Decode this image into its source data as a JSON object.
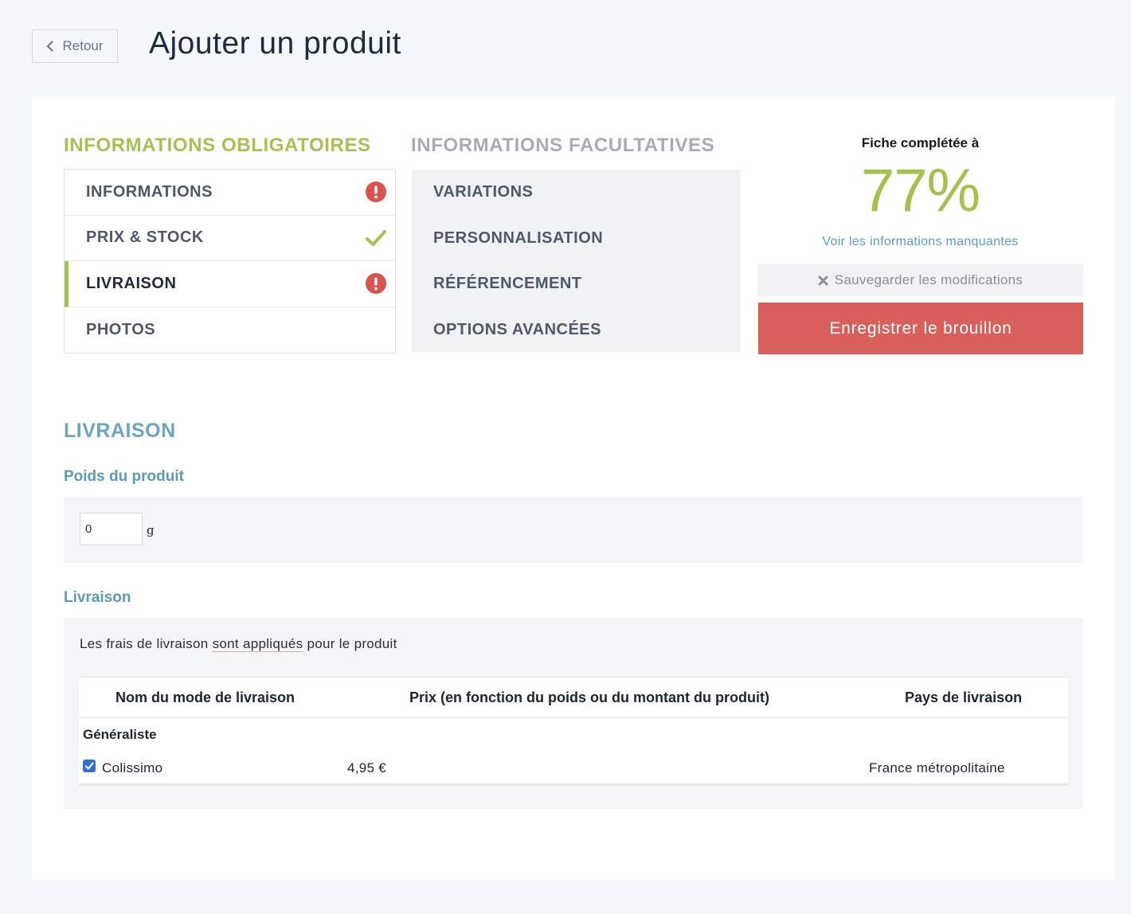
{
  "header": {
    "back_label": "Retour",
    "title": "Ajouter un produit"
  },
  "mandatory": {
    "heading": "INFORMATIONS OBLIGATOIRES",
    "items": [
      {
        "label": "INFORMATIONS",
        "status": "error"
      },
      {
        "label": "PRIX & STOCK",
        "status": "ok"
      },
      {
        "label": "LIVRAISON",
        "status": "error",
        "active": true
      },
      {
        "label": "PHOTOS",
        "status": "none"
      }
    ]
  },
  "optional": {
    "heading": "INFORMATIONS FACULTATIVES",
    "items": [
      {
        "label": "VARIATIONS"
      },
      {
        "label": "PERSONNALISATION"
      },
      {
        "label": "RÉFÉRENCEMENT"
      },
      {
        "label": "OPTIONS AVANCÉES"
      }
    ]
  },
  "completion": {
    "label": "Fiche complétée à",
    "percent": "77%",
    "missing_link": "Voir les informations manquantes",
    "save_label": "Sauvegarder les modifications",
    "draft_label": "Enregistrer le brouillon"
  },
  "section": {
    "title": "LIVRAISON",
    "weight": {
      "title": "Poids du produit",
      "value": "0",
      "unit": "g"
    },
    "delivery": {
      "title": "Livraison",
      "text_before": "Les frais de livraison ",
      "text_underlined": "sont appliqués",
      "text_after": " pour le produit",
      "table": {
        "headers": {
          "name": "Nom du mode de livraison",
          "price": "Prix (en fonction du poids ou du montant du produit)",
          "country": "Pays de livraison"
        },
        "group": "Généraliste",
        "row": {
          "checked": true,
          "name": "Colissimo",
          "price": "4,95 €",
          "country": "France métropolitaine"
        }
      }
    }
  },
  "colors": {
    "accent_green": "#a5c24f",
    "link_blue": "#5d9fba",
    "danger_red": "#d9605a",
    "error_icon": "#d9534f"
  }
}
